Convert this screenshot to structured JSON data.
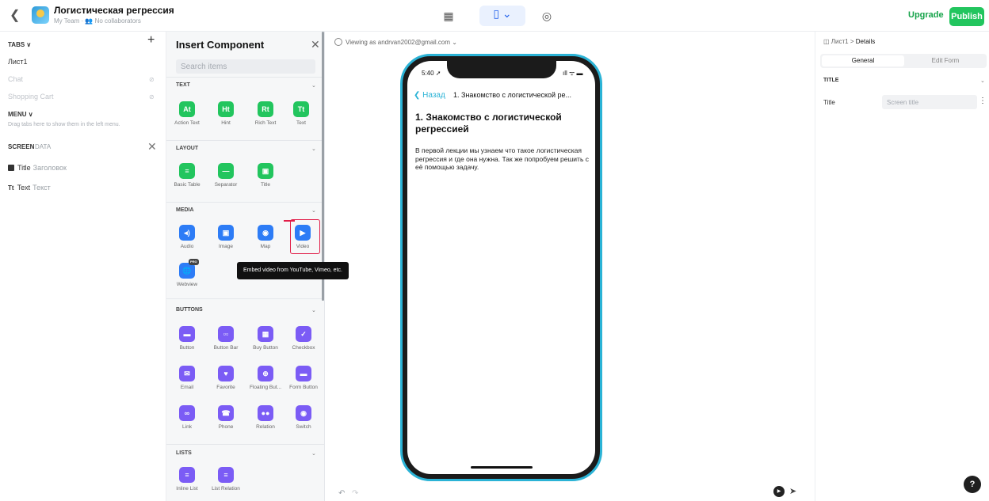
{
  "app": {
    "title": "Логистическая регрессия",
    "subtitle": "My Team · 👥 No collaborators",
    "upgrade_label": "Upgrade",
    "publish_label": "Publish"
  },
  "left_panel": {
    "tabs_heading": "TABS ∨",
    "tabs": [
      "Лист1",
      "Chat",
      "Shopping Cart"
    ],
    "menu_heading": "MENU ∨",
    "menu_hint": "Drag tabs here to show them in the left menu.",
    "screen_tab": "SCREEN",
    "data_tab": "DATA",
    "screen_items": [
      {
        "kind": "Title",
        "value": "Заголовок"
      },
      {
        "kind": "Text",
        "value": "Текст"
      }
    ]
  },
  "insert_panel": {
    "title": "Insert Component",
    "search_placeholder": "Search items",
    "sections": [
      {
        "label": "TEXT",
        "items": [
          "Action Text",
          "Hint",
          "Rich Text",
          "Text"
        ]
      },
      {
        "label": "LAYOUT",
        "items": [
          "Basic Table",
          "Separator",
          "Title"
        ]
      },
      {
        "label": "MEDIA",
        "items": [
          "Audio",
          "Image",
          "Map",
          "Video",
          "Webview"
        ]
      },
      {
        "label": "BUTTONS",
        "items": [
          "Button",
          "Button Bar",
          "Buy Button",
          "Checkbox",
          "Email",
          "Favorite",
          "Floating But...",
          "Form Button",
          "Link",
          "Phone",
          "Relation",
          "Switch"
        ]
      },
      {
        "label": "LISTS",
        "items": [
          "Inline List",
          "List Relation"
        ]
      }
    ],
    "tile_glyphs": {
      "action_text": "At",
      "hint": "Ht",
      "rich_text": "Rt",
      "text": "Tt"
    },
    "pro_badge": "PRO",
    "tooltip": "Embed video from YouTube, Vimeo, etc."
  },
  "canvas": {
    "viewing_as": "Viewing as andrvan2002@gmail.com ⌄",
    "phone": {
      "time": "5:40 ➚",
      "status_icons": "ıll ᯤ ▬",
      "back_label": "❮ Назад",
      "nav_title": "1. Знакомство с логистической ре...",
      "heading": "1. Знакомство с логистической регрессией",
      "body": "В первой лекции мы узнаем что такое логистическая регрессия и где она нужна. Так же попробуем решить с её помощью задачу."
    }
  },
  "right_panel": {
    "breadcrumb_root": "Лист1",
    "breadcrumb_leaf": "Details",
    "tab_general": "General",
    "tab_edit_form": "Edit Form",
    "section_title": "TITLE",
    "field_label": "Title",
    "field_placeholder": "Screen title"
  },
  "colors": {
    "accent_green": "#22c55e",
    "accent_blue": "#2d7cf6",
    "accent_purple": "#7b5cf5",
    "phone_frame": "#2bb3d6",
    "annotation_red": "#e11d48"
  }
}
